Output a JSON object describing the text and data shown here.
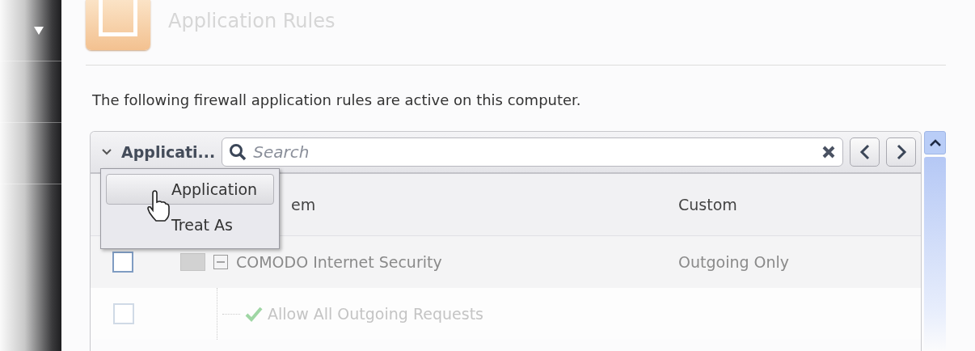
{
  "page": {
    "title": "Application Rules",
    "description": "The following firewall application rules are active on this computer."
  },
  "filter": {
    "label": "Applicati...",
    "expanded": true,
    "options": [
      {
        "label": "Application",
        "selected": true
      },
      {
        "label": "Treat As",
        "selected": false
      }
    ]
  },
  "search": {
    "placeholder": "Search"
  },
  "table": {
    "columns": [
      "em",
      "Custom"
    ],
    "rows": [
      {
        "checked": false,
        "expanded": true,
        "name": "COMODO Internet Security",
        "treat_as": "Outgoing Only",
        "children": [
          {
            "checked": false,
            "name": "Allow All Outgoing Requests"
          }
        ]
      }
    ]
  }
}
